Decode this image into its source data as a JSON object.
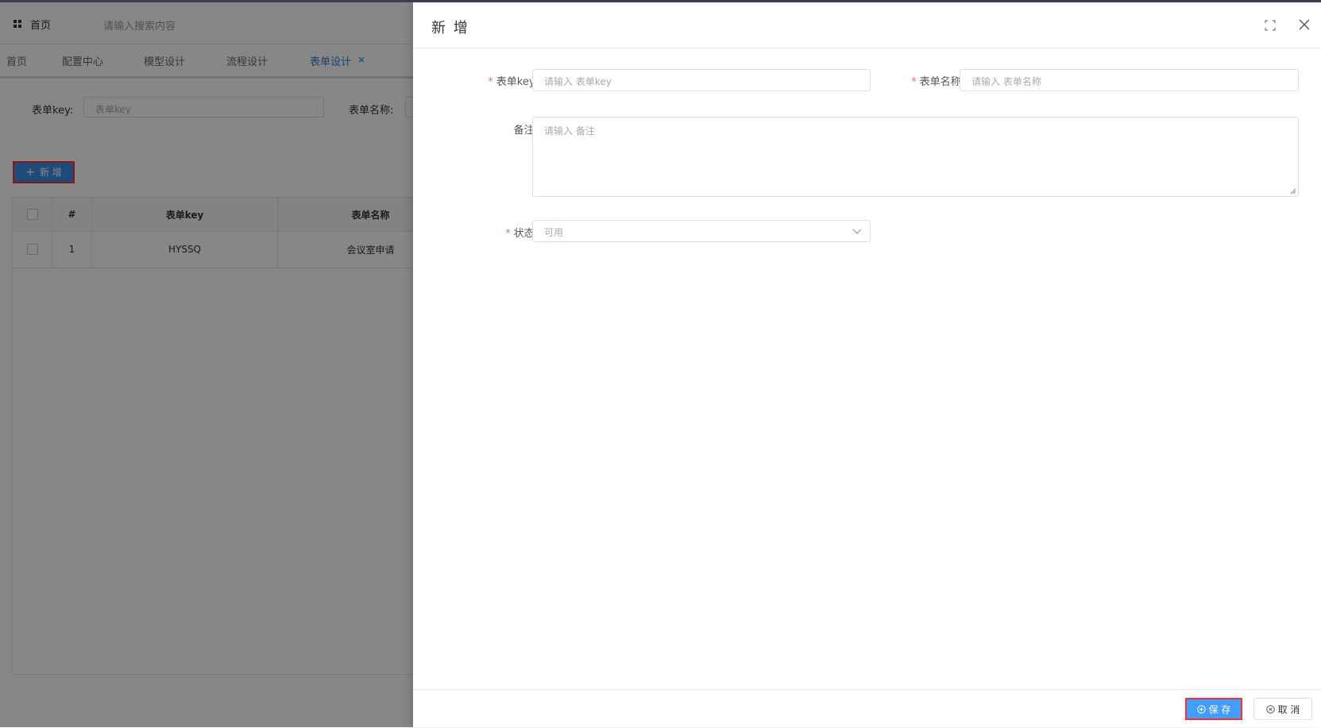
{
  "header": {
    "home_label": "首页",
    "search_placeholder": "请输入搜索内容"
  },
  "tabs": [
    {
      "label": "首页",
      "active": false
    },
    {
      "label": "配置中心",
      "active": false
    },
    {
      "label": "模型设计",
      "active": false
    },
    {
      "label": "流程设计",
      "active": false
    },
    {
      "label": "表单设计",
      "active": true
    }
  ],
  "tab_close": "×",
  "filters": {
    "form_key_label": "表单key:",
    "form_key_placeholder": "表单key",
    "form_name_label": "表单名称:"
  },
  "toolbar": {
    "add_label": "新 增"
  },
  "table": {
    "columns": [
      "#",
      "表单key",
      "表单名称"
    ],
    "rows": [
      {
        "index": "1",
        "form_key": "HYSSQ",
        "form_name": "会议室申请"
      }
    ]
  },
  "drawer": {
    "title": "新 增",
    "form": {
      "form_key_label": "表单key:",
      "form_key_placeholder": "请输入 表单key",
      "form_name_label": "表单名称:",
      "form_name_placeholder": "请输入 表单名称",
      "remark_label": "备注:",
      "remark_placeholder": "请输入 备注",
      "status_label": "状态:",
      "status_value": "可用"
    },
    "footer": {
      "save_label": "保 存",
      "cancel_label": "取 消"
    }
  },
  "colors": {
    "accent": "#409eff",
    "highlight_border": "#ff2d2d",
    "required": "#f56c6c"
  }
}
